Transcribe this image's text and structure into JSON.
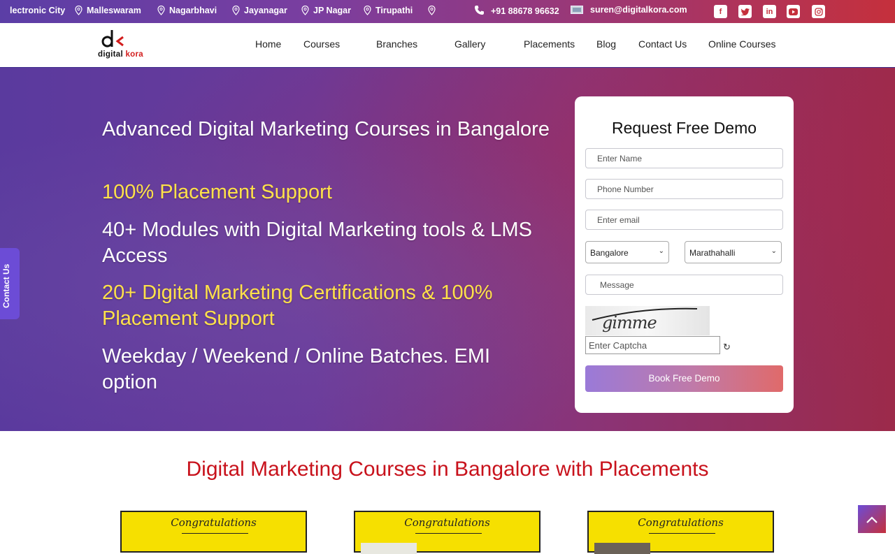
{
  "topbar": {
    "locations": [
      "lectronic City",
      "Malleswaram",
      "Nagarbhavi",
      "Jayanagar",
      "JP Nagar",
      "Tirupathi"
    ],
    "phone": "+91 88678 96632",
    "email": "suren@digitalkora.com",
    "social": [
      "facebook",
      "twitter",
      "linkedin",
      "youtube",
      "instagram"
    ]
  },
  "header": {
    "logo_text_1": "digital",
    "logo_text_2": "kora",
    "nav": [
      "Home",
      "Courses",
      "Branches",
      "Gallery",
      "Placements",
      "Blog",
      "Contact Us",
      "Online Courses"
    ]
  },
  "hero": {
    "line1": "Advanced Digital Marketing Courses in Bangalore",
    "line2": "100% Placement Support",
    "line3": "40+ Modules with Digital Marketing tools & LMS Access",
    "line4": "20+ Digital Marketing Certifications & 100% Placement Support",
    "line5": "Weekday / Weekend / Online Batches. EMI option"
  },
  "contact_tab": "Contact Us",
  "form": {
    "title": "Request Free Demo",
    "name_placeholder": "Enter Name",
    "phone_placeholder": "Phone Number",
    "email_placeholder": "Enter email",
    "city_selected": "Bangalore",
    "branch_selected": "Marathahalli",
    "message_placeholder": "Message",
    "captcha_text": "gimme",
    "captcha_placeholder": "Enter Captcha",
    "submit": "Book Free Demo"
  },
  "section": {
    "title": "Digital Marketing Courses in Bangalore with Placements",
    "cert_text": "Congratulations"
  },
  "colors": {
    "accent_red": "#c8121c",
    "accent_purple": "#6c4cd6",
    "highlight_yellow": "#ffe14a"
  }
}
